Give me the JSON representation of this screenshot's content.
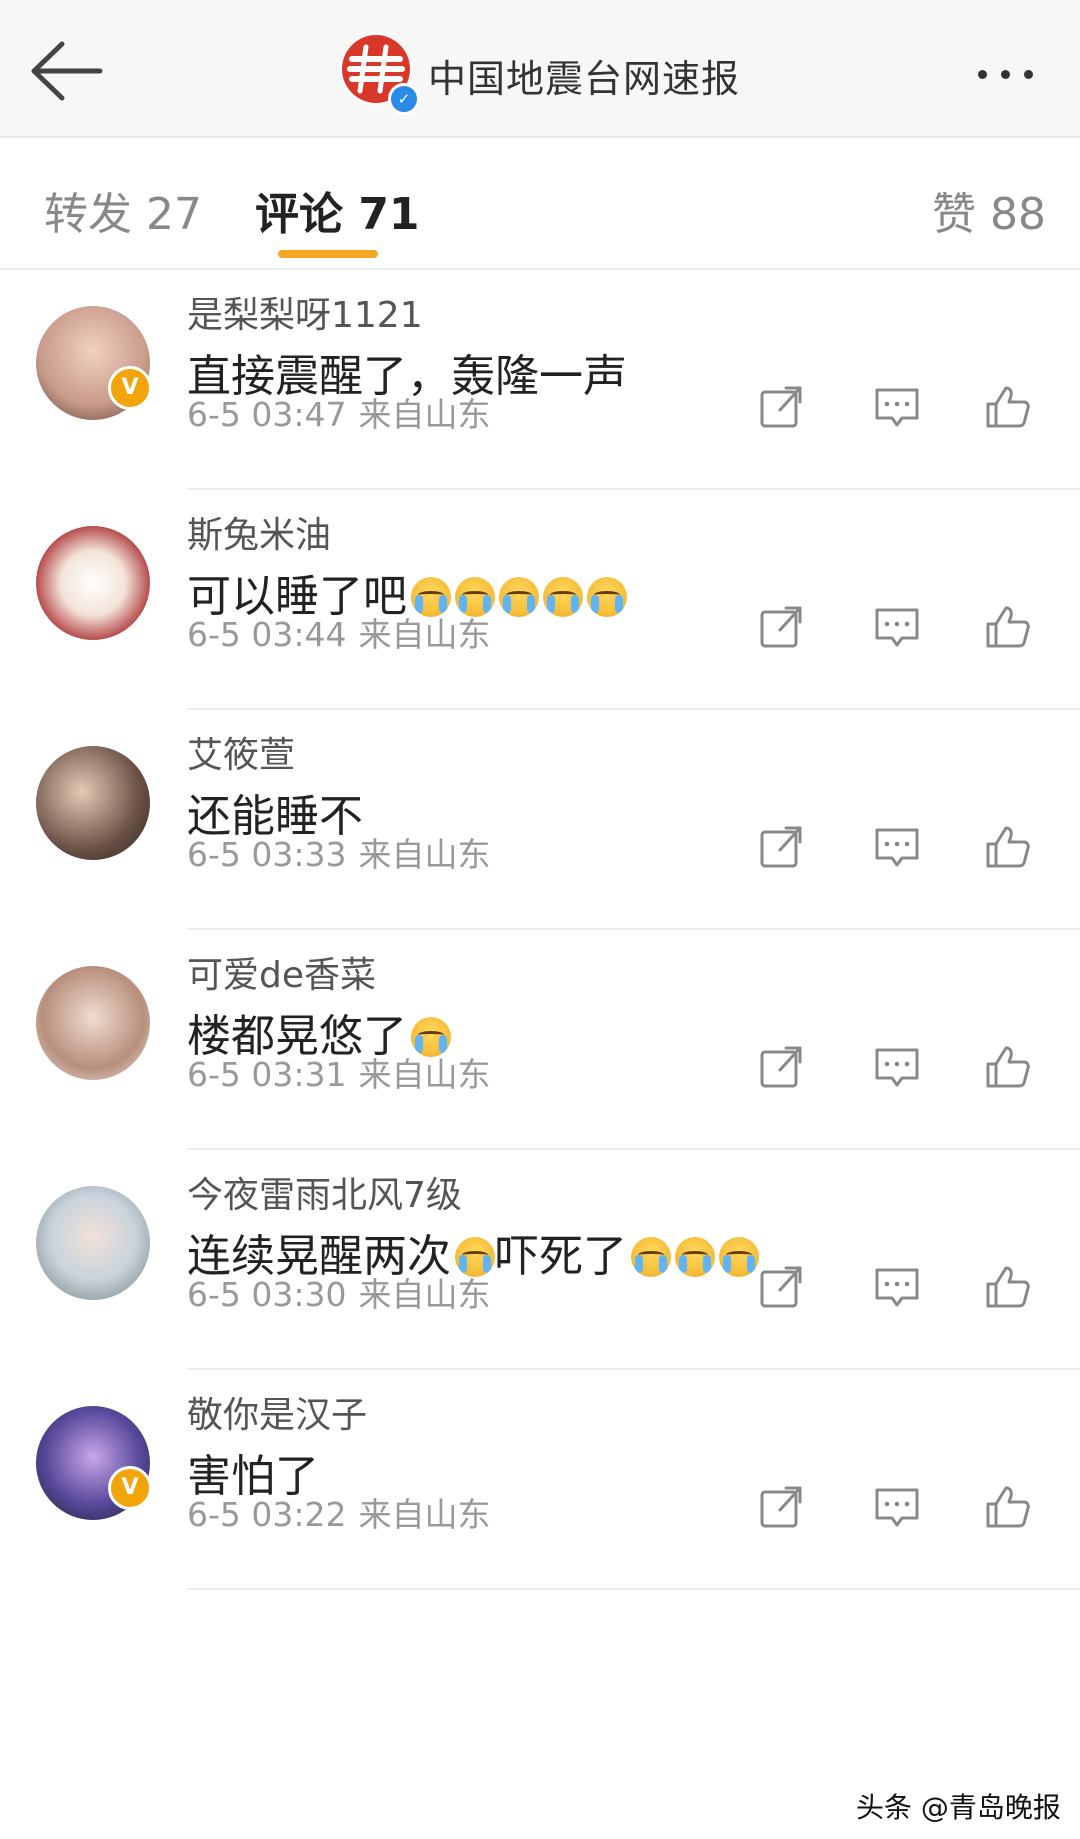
{
  "header": {
    "back_icon": "arrow-left-icon",
    "account_name": "中国地震台网速报",
    "more_icon": "more-horizontal-icon"
  },
  "tabs": {
    "repost": "转发 27",
    "comment": "评论 71",
    "like": "赞 88",
    "active_color": "#f5a623"
  },
  "comments": [
    {
      "username": "是梨梨呀1121",
      "text": "直接震醒了，轰隆一声",
      "emoji_count": 0,
      "emoji_after": 0,
      "text2": "",
      "time": "6-5 03:47",
      "source": "来自山东",
      "verified": true
    },
    {
      "username": "斯兔米油",
      "text": "可以睡了吧",
      "emoji_count": 5,
      "emoji_after": 0,
      "text2": "",
      "time": "6-5 03:44",
      "source": "来自山东",
      "verified": false
    },
    {
      "username": "艾筱萱",
      "text": "还能睡不",
      "emoji_count": 0,
      "emoji_after": 0,
      "text2": "",
      "time": "6-5 03:33",
      "source": "来自山东",
      "verified": false
    },
    {
      "username": "可爱de香菜",
      "text": "楼都晃悠了",
      "emoji_count": 1,
      "emoji_after": 0,
      "text2": "",
      "time": "6-5 03:31",
      "source": "来自山东",
      "verified": false
    },
    {
      "username": "今夜雷雨北风7级",
      "text": "连续晃醒两次",
      "emoji_count": 1,
      "emoji_after": 3,
      "text2": "吓死了",
      "time": "6-5 03:30",
      "source": "来自山东",
      "verified": false
    },
    {
      "username": "敬你是汉子",
      "text": "害怕了",
      "emoji_count": 0,
      "emoji_after": 0,
      "text2": "",
      "time": "6-5 03:22",
      "source": "来自山东",
      "verified": true
    }
  ],
  "watermark": "头条 @青岛晚报"
}
